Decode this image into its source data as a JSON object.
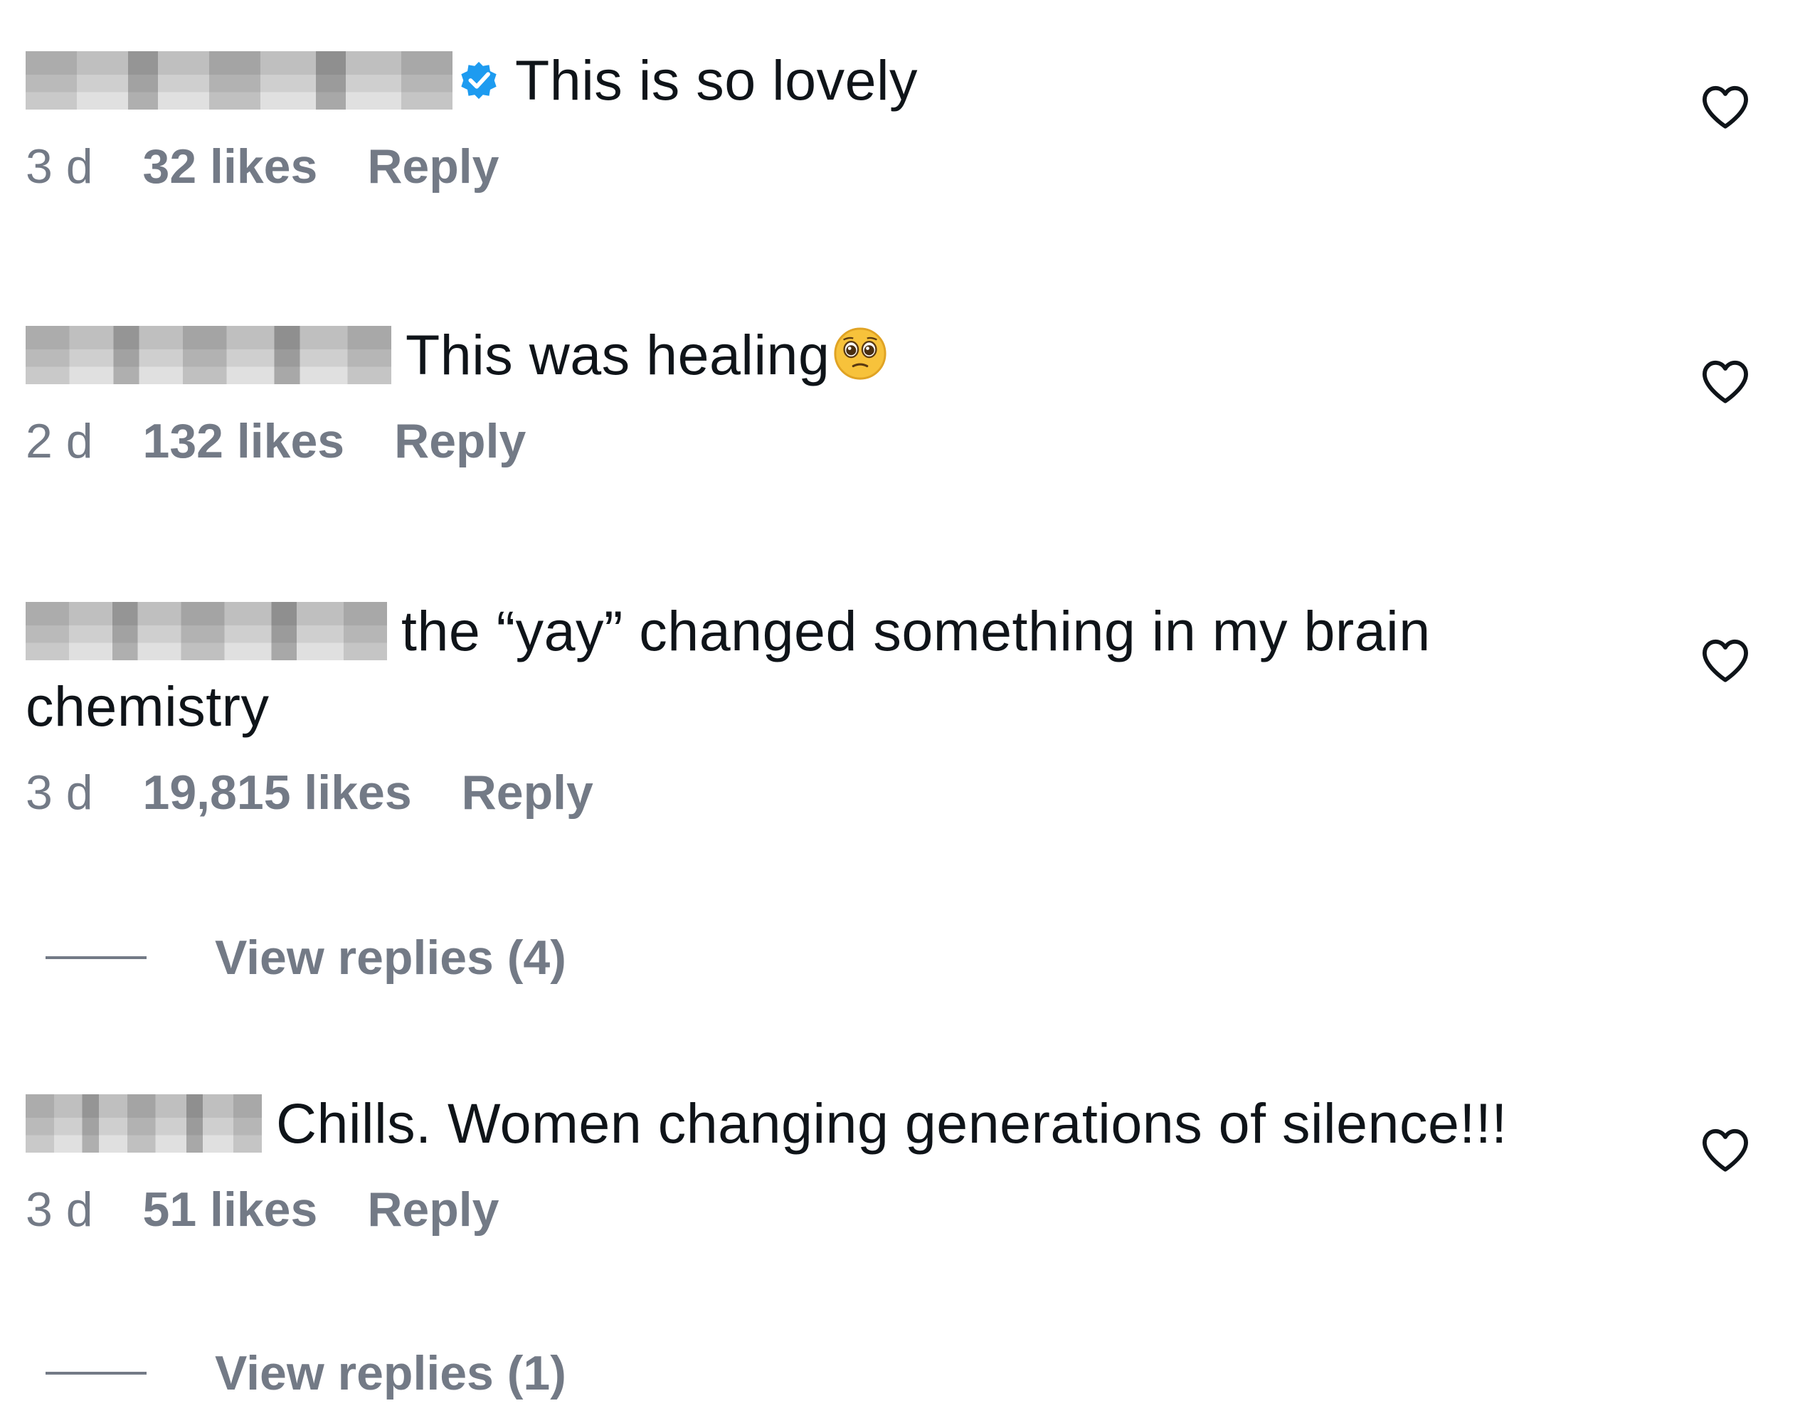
{
  "comments": [
    {
      "text": "This is so lovely",
      "verified": true,
      "time": "3 d",
      "likes": "32 likes",
      "reply": "Reply",
      "like_icon": "heart-outline-icon"
    },
    {
      "text": "This was healing",
      "emoji": "pleading-face-emoji",
      "time": "2 d",
      "likes": "132 likes",
      "reply": "Reply",
      "like_icon": "heart-outline-icon"
    },
    {
      "text": "the “yay” changed something in my brain chemistry",
      "time": "3 d",
      "likes": "19,815 likes",
      "reply": "Reply",
      "like_icon": "heart-outline-icon",
      "view_replies": "View replies (4)"
    },
    {
      "text": "Chills. Women changing generations of silence!!!",
      "time": "3 d",
      "likes": "51 likes",
      "reply": "Reply",
      "like_icon": "heart-outline-icon",
      "view_replies": "View replies (1)"
    }
  ],
  "colors": {
    "text": "#0f1419",
    "muted": "#737a86",
    "verified_blue": "#1d9bf0"
  }
}
